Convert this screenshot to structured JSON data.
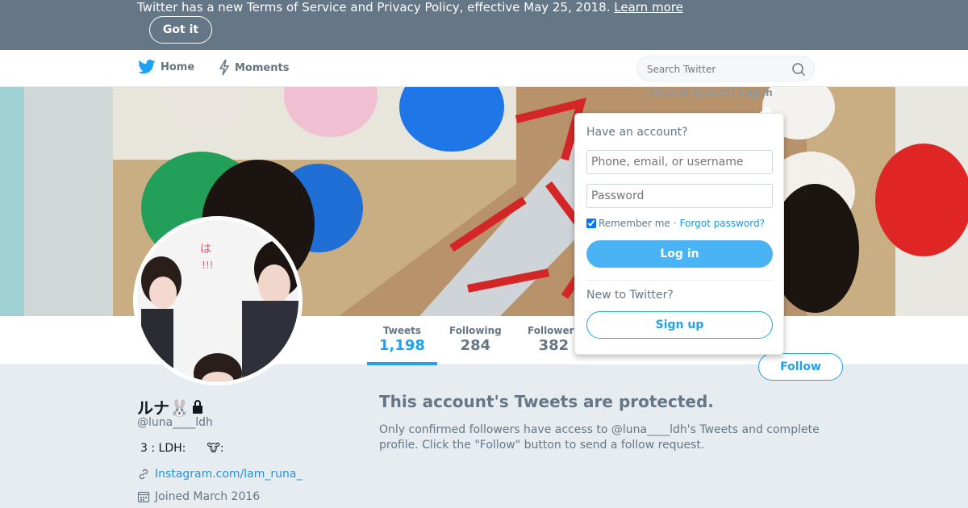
{
  "notice": {
    "text": "Twitter has a new Terms of Service and Privacy Policy, effective May 25, 2018.",
    "link": "Learn more",
    "button": "Got it"
  },
  "nav": {
    "home": "Home",
    "moments": "Moments",
    "search_placeholder": "Search Twitter"
  },
  "login_hint": {
    "text": "Have an account?",
    "link": "Log in"
  },
  "profile": {
    "name": "ルナ🐰",
    "handle": "@luna____ldh",
    "bio_text": "3 : LDH:",
    "bio_emoji": "🐮:",
    "url": "Instagram.com/lam_runa_",
    "joined": "Joined March 2016"
  },
  "stats": [
    {
      "label": "Tweets",
      "value": "1,198"
    },
    {
      "label": "Following",
      "value": "284"
    },
    {
      "label": "Followers",
      "value": "382"
    }
  ],
  "follow_button": "Follow",
  "protected": {
    "title": "This account's Tweets are protected.",
    "body": "Only confirmed followers have access to @luna____ldh's Tweets and complete profile. Click the \"Follow\" button to send a follow request."
  },
  "login_dropdown": {
    "heading": "Have an account?",
    "username_placeholder": "Phone, email, or username",
    "password_placeholder": "Password",
    "remember": "Remember me",
    "separator": "·",
    "forgot": "Forgot password?",
    "login_button": "Log in",
    "new_heading": "New to Twitter?",
    "signup_button": "Sign up"
  },
  "colors": {
    "accent": "#1da1f2",
    "banner": "#657786"
  }
}
